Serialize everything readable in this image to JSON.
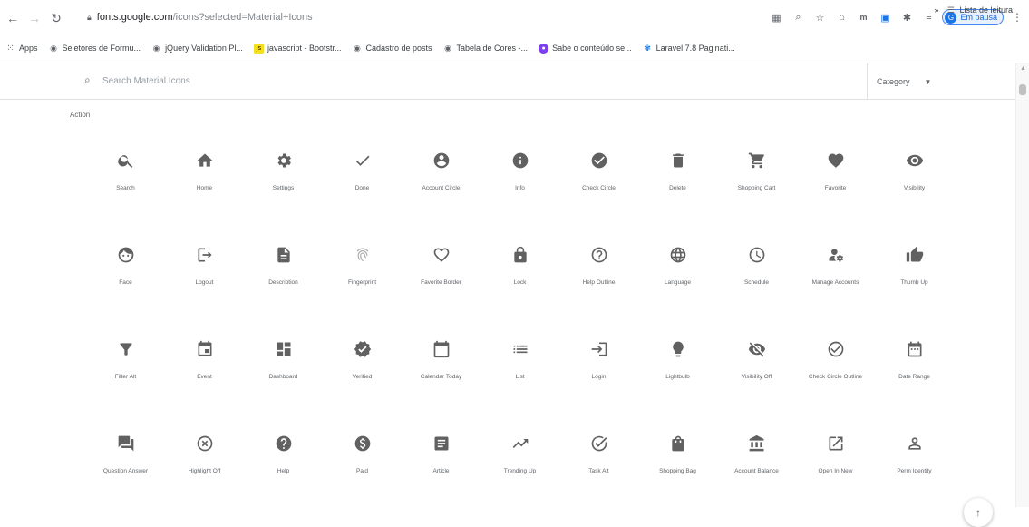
{
  "browser": {
    "url_host": "fonts.google.com",
    "url_path": "/icons?selected=Material+Icons",
    "profile_label": "Em pausa",
    "profile_initial": "G"
  },
  "bookmarks": [
    {
      "label": "Apps",
      "icon": "apps-icon"
    },
    {
      "label": "Seletores de Formu...",
      "icon": "globe-icon"
    },
    {
      "label": "jQuery Validation Pl...",
      "icon": "globe-icon"
    },
    {
      "label": "javascript - Bootstr...",
      "icon": "js-icon"
    },
    {
      "label": "Cadastro de posts",
      "icon": "globe-icon"
    },
    {
      "label": "Tabela de Cores -...",
      "icon": "globe-icon"
    },
    {
      "label": "Sabe o conteúdo se...",
      "icon": "purple-icon"
    },
    {
      "label": "Laravel 7.8 Paginati...",
      "icon": "laravel-icon"
    }
  ],
  "bookmarks_more": "»",
  "reading_list": "Lista de leitura",
  "search": {
    "placeholder": "Search Material Icons"
  },
  "category": {
    "label": "Category"
  },
  "section": {
    "title": "Action"
  },
  "icons": [
    [
      {
        "name": "search",
        "label": "Search"
      },
      {
        "name": "home",
        "label": "Home"
      },
      {
        "name": "settings",
        "label": "Settings"
      },
      {
        "name": "done",
        "label": "Done"
      },
      {
        "name": "account-circle",
        "label": "Account Circle"
      },
      {
        "name": "info",
        "label": "Info"
      },
      {
        "name": "check-circle",
        "label": "Check Circle"
      },
      {
        "name": "delete",
        "label": "Delete"
      },
      {
        "name": "shopping-cart",
        "label": "Shopping Cart"
      },
      {
        "name": "favorite",
        "label": "Favorite"
      },
      {
        "name": "visibility",
        "label": "Visibility"
      }
    ],
    [
      {
        "name": "face",
        "label": "Face"
      },
      {
        "name": "logout",
        "label": "Logout"
      },
      {
        "name": "description",
        "label": "Description"
      },
      {
        "name": "fingerprint",
        "label": "Fingerprint"
      },
      {
        "name": "favorite-border",
        "label": "Favorite Border"
      },
      {
        "name": "lock",
        "label": "Lock"
      },
      {
        "name": "help-outline",
        "label": "Help Outline"
      },
      {
        "name": "language",
        "label": "Language"
      },
      {
        "name": "schedule",
        "label": "Schedule"
      },
      {
        "name": "manage-accounts",
        "label": "Manage Accounts"
      },
      {
        "name": "thumb-up",
        "label": "Thumb Up"
      }
    ],
    [
      {
        "name": "filter-alt",
        "label": "Filter Alt"
      },
      {
        "name": "event",
        "label": "Event"
      },
      {
        "name": "dashboard",
        "label": "Dashboard"
      },
      {
        "name": "verified",
        "label": "Verified"
      },
      {
        "name": "calendar-today",
        "label": "Calendar Today"
      },
      {
        "name": "list",
        "label": "List"
      },
      {
        "name": "login",
        "label": "Login"
      },
      {
        "name": "lightbulb",
        "label": "Lightbulb"
      },
      {
        "name": "visibility-off",
        "label": "Visibility Off"
      },
      {
        "name": "check-circle-outline",
        "label": "Check Circle Outline"
      },
      {
        "name": "date-range",
        "label": "Date Range"
      }
    ],
    [
      {
        "name": "question-answer",
        "label": "Question Answer"
      },
      {
        "name": "highlight-off",
        "label": "Highlight Off"
      },
      {
        "name": "help",
        "label": "Help"
      },
      {
        "name": "paid",
        "label": "Paid"
      },
      {
        "name": "article",
        "label": "Article"
      },
      {
        "name": "trending-up",
        "label": "Trending Up"
      },
      {
        "name": "task-alt",
        "label": "Task Alt"
      },
      {
        "name": "shopping-bag",
        "label": "Shopping Bag"
      },
      {
        "name": "account-balance",
        "label": "Account Balance"
      },
      {
        "name": "open-in-new",
        "label": "Open In New"
      },
      {
        "name": "perm-identity",
        "label": "Perm Identity"
      }
    ]
  ]
}
